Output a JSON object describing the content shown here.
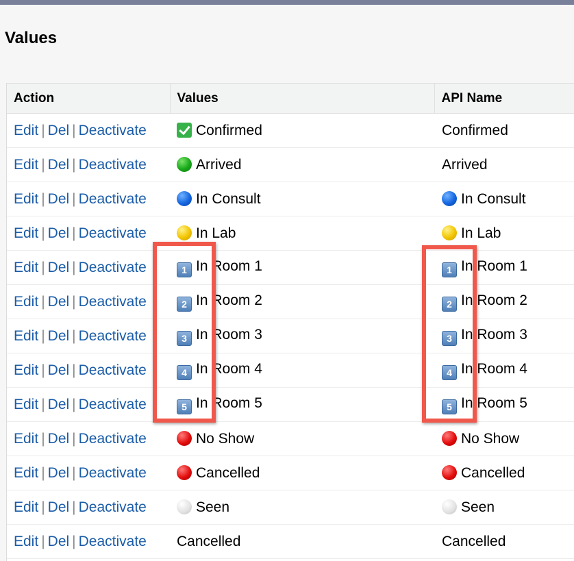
{
  "section_title": "Values",
  "columns": {
    "action": "Action",
    "values": "Values",
    "api": "API Name"
  },
  "actions": {
    "edit": "Edit",
    "del": "Del",
    "deactivate": "Deactivate",
    "sep": "|"
  },
  "rows": [
    {
      "value": "Confirmed",
      "api": "Confirmed",
      "icon": "check-mark-icon",
      "api_icon": ""
    },
    {
      "value": "Arrived",
      "api": "Arrived",
      "icon": "green-circle-icon",
      "api_icon": ""
    },
    {
      "value": "In Consult",
      "api": "In Consult",
      "icon": "blue-circle-icon",
      "api_icon": "blue-circle-icon"
    },
    {
      "value": "In Lab",
      "api": "In Lab",
      "icon": "yellow-circle-icon",
      "api_icon": "yellow-circle-icon"
    },
    {
      "value": "In Room 1",
      "api": "In Room 1",
      "icon": "keycap-1-icon",
      "api_icon": "keycap-1-icon"
    },
    {
      "value": "In Room 2",
      "api": "In Room 2",
      "icon": "keycap-2-icon",
      "api_icon": "keycap-2-icon"
    },
    {
      "value": "In Room 3",
      "api": "In Room 3",
      "icon": "keycap-3-icon",
      "api_icon": "keycap-3-icon"
    },
    {
      "value": "In Room 4",
      "api": "In Room 4",
      "icon": "keycap-4-icon",
      "api_icon": "keycap-4-icon"
    },
    {
      "value": "In Room 5",
      "api": "In Room 5",
      "icon": "keycap-5-icon",
      "api_icon": "keycap-5-icon"
    },
    {
      "value": "No Show",
      "api": "No Show",
      "icon": "red-circle-icon",
      "api_icon": "red-circle-icon"
    },
    {
      "value": "Cancelled",
      "api": "Cancelled",
      "icon": "red-circle-icon",
      "api_icon": "red-circle-icon"
    },
    {
      "value": "Seen",
      "api": "Seen",
      "icon": "white-circle-icon",
      "api_icon": "white-circle-icon"
    },
    {
      "value": "Cancelled",
      "api": "Cancelled",
      "icon": "",
      "api_icon": ""
    }
  ],
  "keycaps": {
    "k1": "1",
    "k2": "2",
    "k3": "3",
    "k4": "4",
    "k5": "5"
  },
  "colors": {
    "link": "#1a5ca8",
    "highlight": "#f0584c",
    "topbar": "#79809a"
  }
}
